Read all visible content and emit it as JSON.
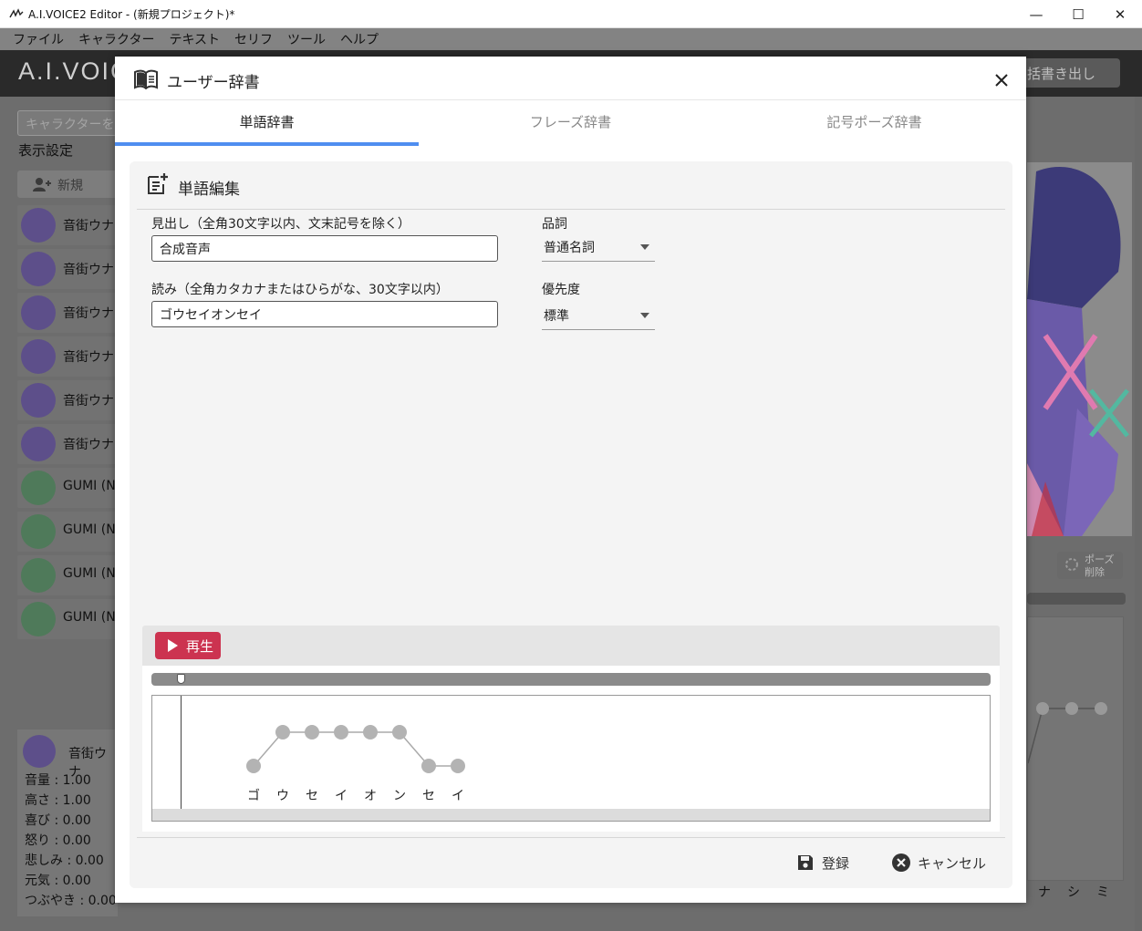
{
  "window": {
    "title": "A.I.VOICE2 Editor - (新規プロジェクト)*",
    "controls": {
      "minimize": "—",
      "maximize": "☐",
      "close": "✕"
    }
  },
  "menu": {
    "items": [
      "ファイル",
      "キャラクター",
      "テキスト",
      "セリフ",
      "ツール",
      "ヘルプ"
    ]
  },
  "background": {
    "logo": "A.I.VOIC",
    "export_label": "括書き出し",
    "search_placeholder": "キャラクターを",
    "display_settings": "表示設定",
    "new_button": "新規",
    "characters": [
      "音街ウナ",
      "音街ウナ",
      "音街ウナ",
      "音街ウナ",
      "音街ウナ",
      "音街ウナ",
      "GUMI (NV",
      "GUMI (NV",
      "GUMI (NV",
      "GUMI (NV"
    ],
    "status_name": "音街ウナ",
    "status": [
      "音量 : 1.00",
      "高さ : 1.00",
      "喜び : 0.00",
      "怒り : 0.00",
      "悲しみ : 0.00",
      "元気 : 0.00",
      "つぶやき : 0.00"
    ],
    "pause_delete": [
      "ポーズ",
      "削除"
    ],
    "kana_tail": [
      "ナ",
      "シ",
      "ミ"
    ]
  },
  "dialog": {
    "title": "ユーザー辞書",
    "tabs": [
      {
        "label": "単語辞書",
        "active": true
      },
      {
        "label": "フレーズ辞書",
        "active": false
      },
      {
        "label": "記号ポーズ辞書",
        "active": false
      }
    ],
    "accent": "#4f8ef0",
    "section_title": "単語編集",
    "headword": {
      "label": "見出し（全角30文字以内、文末記号を除く）",
      "value": "合成音声"
    },
    "reading": {
      "label": "読み（全角カタカナまたはひらがな、30文字以内）",
      "value": "ゴウセイオンセイ"
    },
    "pos": {
      "label": "品詞",
      "value": "普通名詞"
    },
    "priority": {
      "label": "優先度",
      "value": "標準"
    },
    "player": {
      "play_label": "再生",
      "play_color": "#cc3350",
      "morae": [
        "ゴ",
        "ウ",
        "セ",
        "イ",
        "オ",
        "ン",
        "セ",
        "イ"
      ],
      "accent_levels": [
        "low",
        "high",
        "high",
        "high",
        "high",
        "high",
        "low",
        "low"
      ]
    },
    "actions": {
      "register": "登録",
      "cancel": "キャンセル"
    }
  }
}
